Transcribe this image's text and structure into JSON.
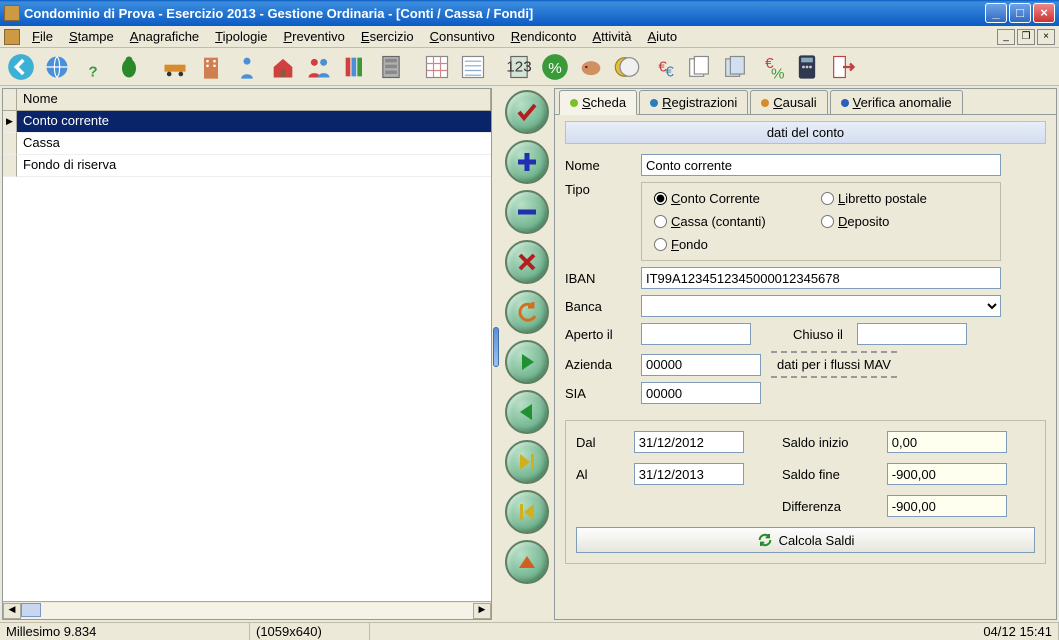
{
  "window": {
    "title": "Condominio di Prova - Esercizio 2013 - Gestione Ordinaria - [Conti / Cassa / Fondi]"
  },
  "menu": {
    "items": [
      "File",
      "Stampe",
      "Anagrafiche",
      "Tipologie",
      "Preventivo",
      "Esercizio",
      "Consuntivo",
      "Rendiconto",
      "Attività",
      "Aiuto"
    ]
  },
  "list": {
    "header": "Nome",
    "rows": [
      "Conto corrente",
      "Cassa",
      "Fondo di riserva"
    ],
    "selected": 0
  },
  "tabs": {
    "items": [
      {
        "label": "Scheda",
        "accel": "S",
        "color": "#7cbf2a"
      },
      {
        "label": "Registrazioni",
        "accel": "R",
        "color": "#2a7cbf"
      },
      {
        "label": "Causali",
        "accel": "C",
        "color": "#d98a2a"
      },
      {
        "label": "Verifica anomalie",
        "accel": "V",
        "color": "#2a5fbf"
      }
    ],
    "active": 0
  },
  "form": {
    "section": "dati del conto",
    "labels": {
      "nome": "Nome",
      "tipo": "Tipo",
      "iban": "IBAN",
      "banca": "Banca",
      "aperto": "Aperto il",
      "chiuso": "Chiuso il",
      "azienda": "Azienda",
      "sia": "SIA",
      "mav": "dati per i flussi MAV",
      "dal": "Dal",
      "al": "Al",
      "saldo_inizio": "Saldo inizio",
      "saldo_fine": "Saldo fine",
      "differenza": "Differenza",
      "calcola": "Calcola Saldi"
    },
    "values": {
      "nome": "Conto corrente",
      "tipo_options": [
        "Conto Corrente",
        "Libretto postale",
        "Cassa (contanti)",
        "Deposito",
        "Fondo"
      ],
      "tipo_selected": 0,
      "iban": "IT99A1234512345000012345678",
      "banca": "",
      "aperto": "",
      "chiuso": "",
      "azienda": "00000",
      "sia": "00000",
      "dal": "31/12/2012",
      "al": "31/12/2013",
      "saldo_inizio": "0,00",
      "saldo_fine": "-900,00",
      "differenza": "-900,00"
    }
  },
  "status": {
    "app": "Millesimo 9.834",
    "dim": "(1059x640)",
    "clock": "04/12 15:41"
  }
}
